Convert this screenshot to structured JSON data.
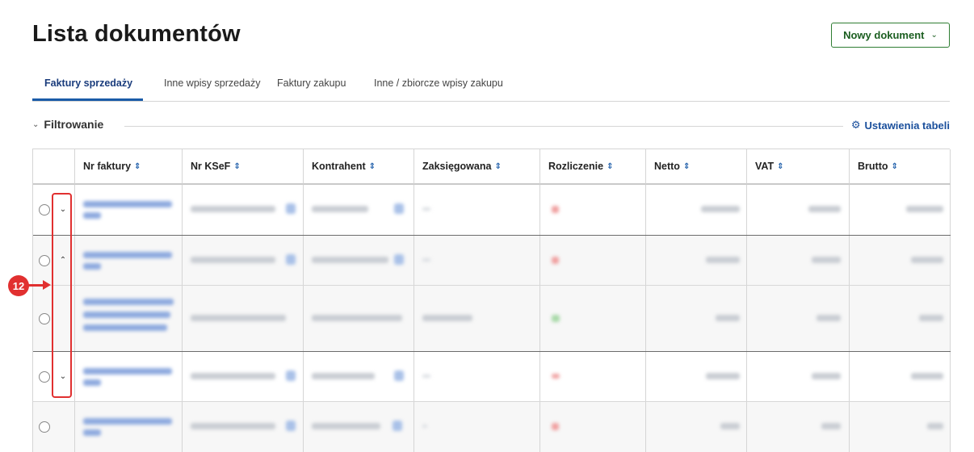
{
  "page": {
    "title": "Lista dokumentów",
    "new_document": "Nowy dokument"
  },
  "tabs": [
    {
      "label": "Faktury sprzedaży",
      "active": true
    },
    {
      "label": "Inne wpisy sprzedaży",
      "active": false
    },
    {
      "label": "Faktury zakupu",
      "active": false
    },
    {
      "label": "Inne / zbiorcze wpisy zakupu",
      "active": false
    }
  ],
  "filter": {
    "label": "Filtrowanie",
    "table_settings": "Ustawienia tabeli"
  },
  "table": {
    "columns": [
      "Nr faktury",
      "Nr KSeF",
      "Kontrahent",
      "Zaksięgowana",
      "Rozliczenie",
      "Netto",
      "VAT",
      "Brutto"
    ],
    "rows": [
      {
        "expander": "collapsed",
        "settlement_status": "red",
        "content_obscured": true
      },
      {
        "expander": "expanded",
        "settlement_status": "red",
        "content_obscured": true
      },
      {
        "expander": "none",
        "settlement_status": "green",
        "content_obscured": true
      },
      {
        "expander": "collapsed",
        "settlement_status": "red",
        "content_obscured": true
      },
      {
        "expander": "none",
        "settlement_status": "red",
        "content_obscured": true
      }
    ]
  },
  "annotation": {
    "badge": "12",
    "color": "#e13030"
  },
  "colors": {
    "accent": "#1a5ba8",
    "button_border": "#2e7d32",
    "title": "#1a1a1a"
  }
}
